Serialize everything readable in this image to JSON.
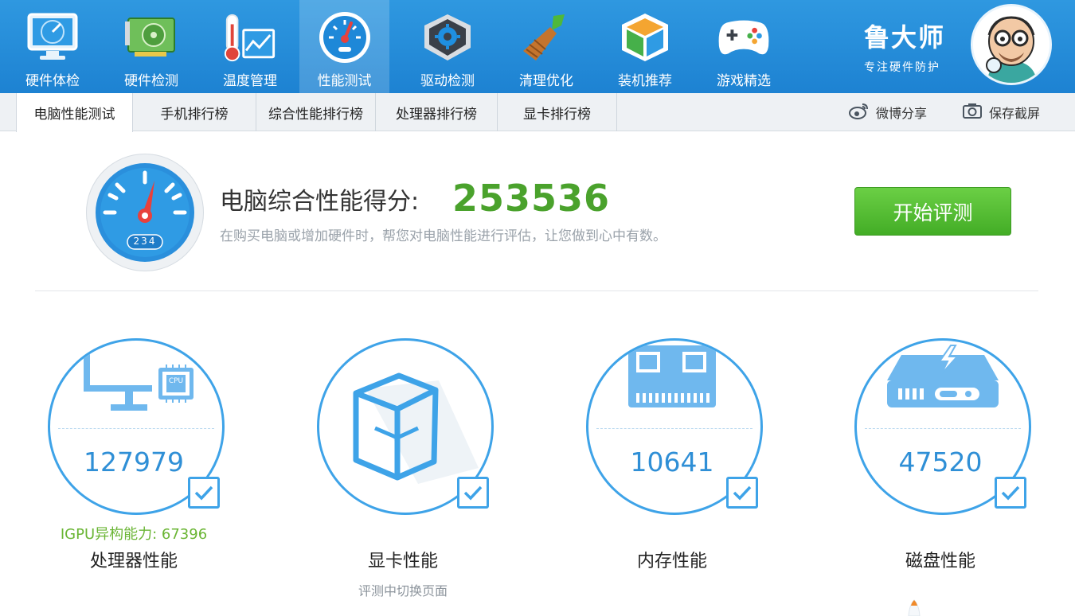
{
  "nav": {
    "items": [
      {
        "label": "硬件体检",
        "icon": "monitor-radar-icon"
      },
      {
        "label": "硬件检测",
        "icon": "graphics-card-icon"
      },
      {
        "label": "温度管理",
        "icon": "thermometer-icon"
      },
      {
        "label": "性能测试",
        "icon": "speedometer-icon"
      },
      {
        "label": "驱动检测",
        "icon": "driver-gear-icon"
      },
      {
        "label": "清理优化",
        "icon": "broom-icon"
      },
      {
        "label": "装机推荐",
        "icon": "cube-icon"
      },
      {
        "label": "游戏精选",
        "icon": "gamepad-icon"
      }
    ],
    "active_index": 3
  },
  "brand": {
    "name": "鲁大师",
    "slogan": "专注硬件防护"
  },
  "tabs": {
    "items": [
      "电脑性能测试",
      "手机排行榜",
      "综合性能排行榜",
      "处理器排行榜",
      "显卡排行榜"
    ],
    "active_index": 0,
    "weibo_share": "微博分享",
    "save_screenshot": "保存截屏"
  },
  "score": {
    "title": "电脑综合性能得分:",
    "value": "253536",
    "description": "在购买电脑或增加硬件时，帮您对电脑性能进行评估，让您做到心中有数。",
    "gauge_reading": "234",
    "start_button": "开始评测"
  },
  "components": [
    {
      "name": "处理器性能",
      "score": "127979",
      "extra": "IGPU异构能力: 67396",
      "sub": "",
      "checked": true,
      "icon": "cpu-monitor-icon",
      "chip_label": "CPU"
    },
    {
      "name": "显卡性能",
      "score": "",
      "extra": "",
      "sub": "评测中切换页面",
      "checked": true,
      "icon": "gpu-cube-icon"
    },
    {
      "name": "内存性能",
      "score": "10641",
      "extra": "",
      "sub": "",
      "checked": true,
      "icon": "memory-module-icon"
    },
    {
      "name": "磁盘性能",
      "score": "47520",
      "extra": "",
      "sub": "",
      "checked": true,
      "icon": "disk-drive-icon"
    }
  ],
  "colors": {
    "nav_bg": "#1d82d2",
    "score_green": "#4aa22c",
    "accent_blue": "#3ea3e8",
    "button_green": "#43ad26",
    "igpu_green": "#6ab534"
  }
}
